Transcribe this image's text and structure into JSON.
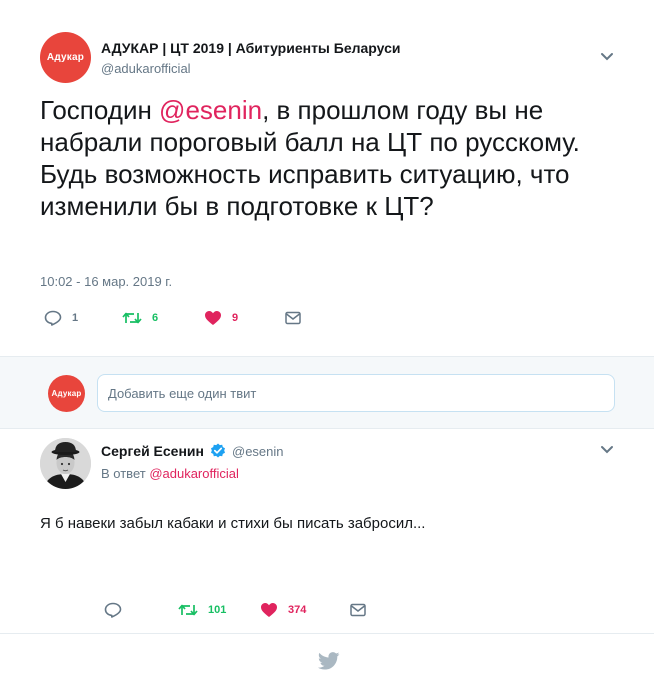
{
  "main_tweet": {
    "avatar_text": "Адукар",
    "display_name": "АДУКАР | ЦТ 2019 | Абитуриенты Беларуси",
    "handle": "@adukarofficial",
    "text_before_mention": "Господин ",
    "mention": "@esenin",
    "text_after_mention": ", в прошлом году вы не набрали пороговый балл на ЦТ по русскому. Будь возможность исправить ситуацию, что изменили бы в подготовке к ЦТ?",
    "timestamp": "10:02 - 16 мар. 2019 г.",
    "replies": "1",
    "retweets": "6",
    "likes": "9"
  },
  "compose": {
    "avatar_text": "Адукар",
    "placeholder": "Добавить еще один твит"
  },
  "reply_tweet": {
    "display_name": "Сергей Есенин",
    "handle": "@esenin",
    "reply_prefix": "В ответ ",
    "reply_to": "@adukarofficial",
    "text": "Я б навеки забыл кабаки и стихи бы писать забросил...",
    "replies": "",
    "retweets": "101",
    "likes": "374"
  },
  "colors": {
    "brand_red": "#e8453c",
    "like_red": "#e0245e",
    "retweet_green": "#17bf63",
    "icon_gray": "#657786",
    "twitter_blue": "#1da1f2",
    "footer_bird": "#aab8c2"
  },
  "icons": {
    "reply": "reply-icon",
    "retweet": "retweet-icon",
    "like": "heart-icon",
    "dm": "envelope-icon",
    "more": "chevron-down-icon",
    "verified": "verified-badge-icon",
    "footer": "twitter-bird-icon"
  }
}
